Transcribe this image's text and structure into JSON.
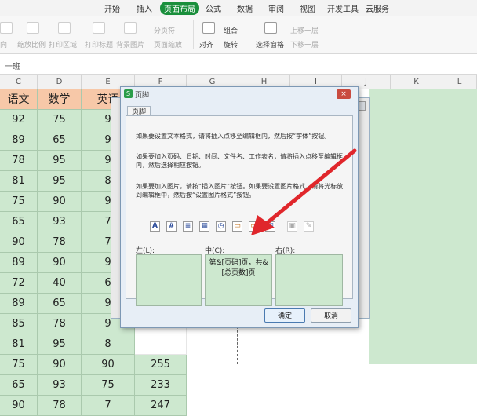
{
  "ribbon": {
    "tabs": [
      "开始",
      "插入",
      "页面布局",
      "公式",
      "数据",
      "审阅",
      "视图",
      "开发工具",
      "云服务"
    ],
    "active_tab": "页面布局",
    "tools": {
      "orientation": "向",
      "shrink": "缩放比例",
      "print_area": "打印区域",
      "print_titles": "打印标题",
      "background": "背景图片",
      "page_break": "分页符",
      "page_zoom": "页面缩放",
      "align": "对齐",
      "group": "组合",
      "rotate": "旋转",
      "select_pane": "选择窗格",
      "bring_forward": "上移一层",
      "send_backward": "下移一层"
    }
  },
  "formula_bar": {
    "content": "一班"
  },
  "grid": {
    "columns": [
      "C",
      "D",
      "E",
      "F",
      "G",
      "H",
      "I",
      "J",
      "K",
      "L"
    ],
    "headers": [
      "语文",
      "数学",
      "英语"
    ],
    "rows": [
      [
        "92",
        "75",
        "9",
        ""
      ],
      [
        "89",
        "65",
        "9",
        ""
      ],
      [
        "78",
        "95",
        "9",
        ""
      ],
      [
        "81",
        "95",
        "8",
        ""
      ],
      [
        "75",
        "90",
        "9",
        ""
      ],
      [
        "65",
        "93",
        "7",
        ""
      ],
      [
        "90",
        "78",
        "7",
        ""
      ],
      [
        "89",
        "90",
        "9",
        ""
      ],
      [
        "72",
        "40",
        "6",
        ""
      ],
      [
        "89",
        "65",
        "9",
        ""
      ],
      [
        "85",
        "78",
        "9",
        ""
      ],
      [
        "81",
        "95",
        "8",
        ""
      ],
      [
        "75",
        "90",
        "90",
        "255"
      ],
      [
        "65",
        "93",
        "75",
        "233"
      ],
      [
        "90",
        "78",
        "7",
        "247"
      ]
    ]
  },
  "dialog": {
    "title": "页脚",
    "tab": "页脚",
    "close": "×",
    "instructions": [
      "如果要设置文本格式，请将插入点移至编辑框内，然后按“字体”按钮。",
      "如果要加入页码、日期、时间、文件名、工作表名，请将插入点移至编辑框内，然后选择相应按钮。",
      "如果要加入图片，请按“插入图片”按钮。如果要设置图片格式，请将光标放到编辑框中，然后按“设置图片格式”按钮。"
    ],
    "toolbar_icons": [
      "font-icon",
      "page-number-icon",
      "total-pages-icon",
      "date-icon",
      "time-icon",
      "file-path-icon",
      "file-name-icon",
      "sheet-name-icon",
      "insert-picture-icon",
      "format-picture-icon"
    ],
    "sections": {
      "left": {
        "label": "左(L):",
        "content": ""
      },
      "center": {
        "label": "中(C):",
        "content": "第&[页码]页，共&[总页数]页"
      },
      "right": {
        "label": "右(R):",
        "content": ""
      }
    },
    "ok_label": "确定",
    "cancel_label": "取消"
  },
  "colors": {
    "accent": "#1a8f3c",
    "cell_green": "#cde8cf",
    "header_orange": "#f7c8a8",
    "arrow_red": "#e0262b"
  }
}
